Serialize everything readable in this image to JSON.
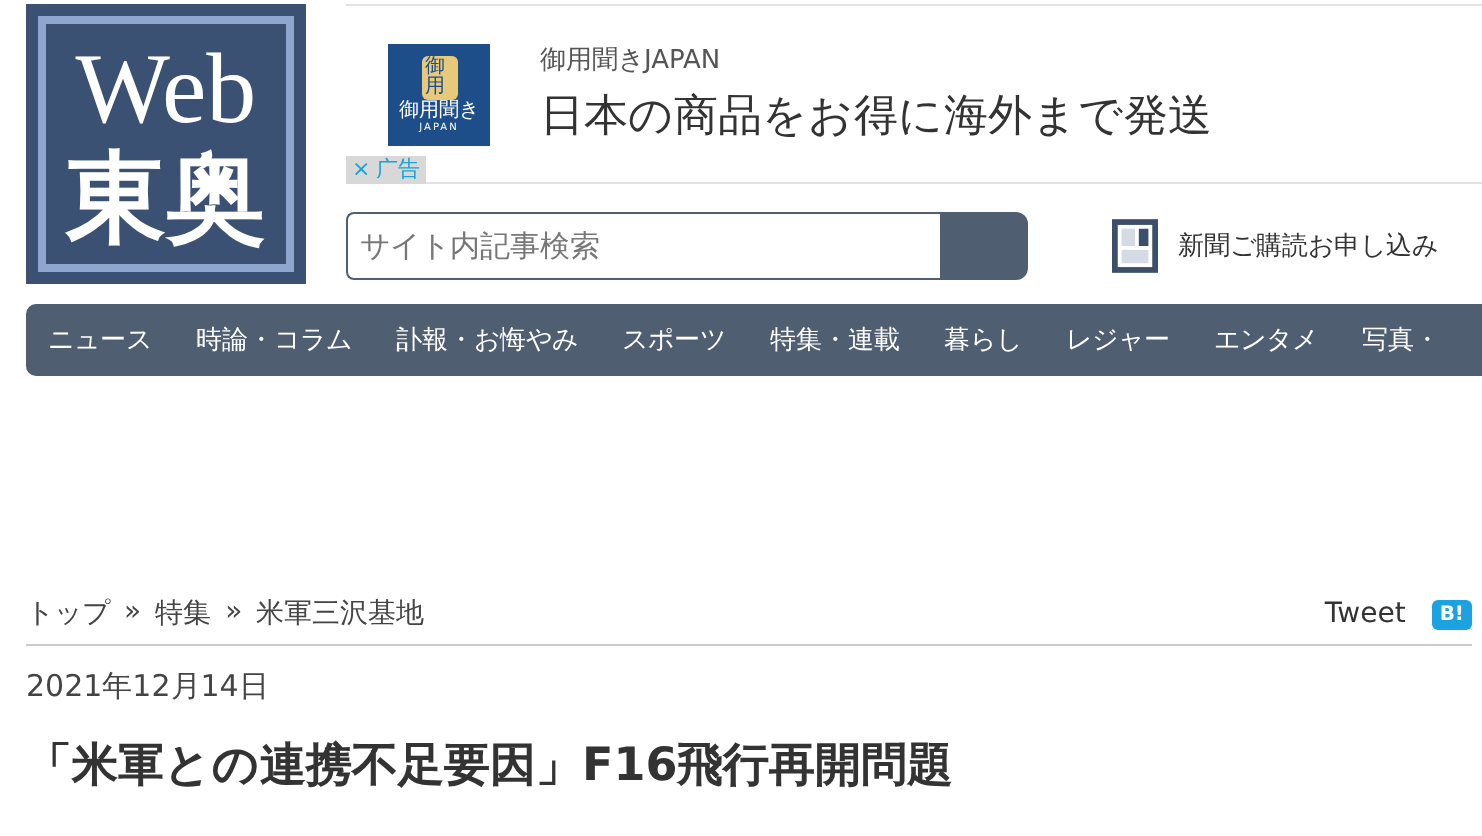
{
  "logo": {
    "line_1": "Web",
    "line_2": "東奥"
  },
  "ad": {
    "logo_top": "御用",
    "logo_name": "御用聞き",
    "logo_sub": "JAPAN",
    "sponsor": "御用聞きJAPAN",
    "headline": "日本の商品をお得に海外まで発送",
    "close": "×",
    "label": "广告"
  },
  "search": {
    "placeholder": "サイト内記事検索"
  },
  "subscribe": {
    "label": "新聞ご購読お申し込み"
  },
  "nav": [
    {
      "label": "ニュース"
    },
    {
      "label": "時論・コラム"
    },
    {
      "label": "訃報・お悔やみ"
    },
    {
      "label": "スポーツ"
    },
    {
      "label": "特集・連載"
    },
    {
      "label": "暮らし"
    },
    {
      "label": "レジャー"
    },
    {
      "label": "エンタメ"
    },
    {
      "label": "写真・"
    }
  ],
  "breadcrumb": [
    {
      "label": "トップ"
    },
    {
      "label": "特集"
    },
    {
      "label": "米軍三沢基地"
    }
  ],
  "breadcrumb_separator": "»",
  "share": {
    "tweet": "Tweet",
    "hatena": "B!"
  },
  "article": {
    "date": "2021年12月14日",
    "title": "「米軍との連携不足要因」F16飛行再開問題"
  }
}
